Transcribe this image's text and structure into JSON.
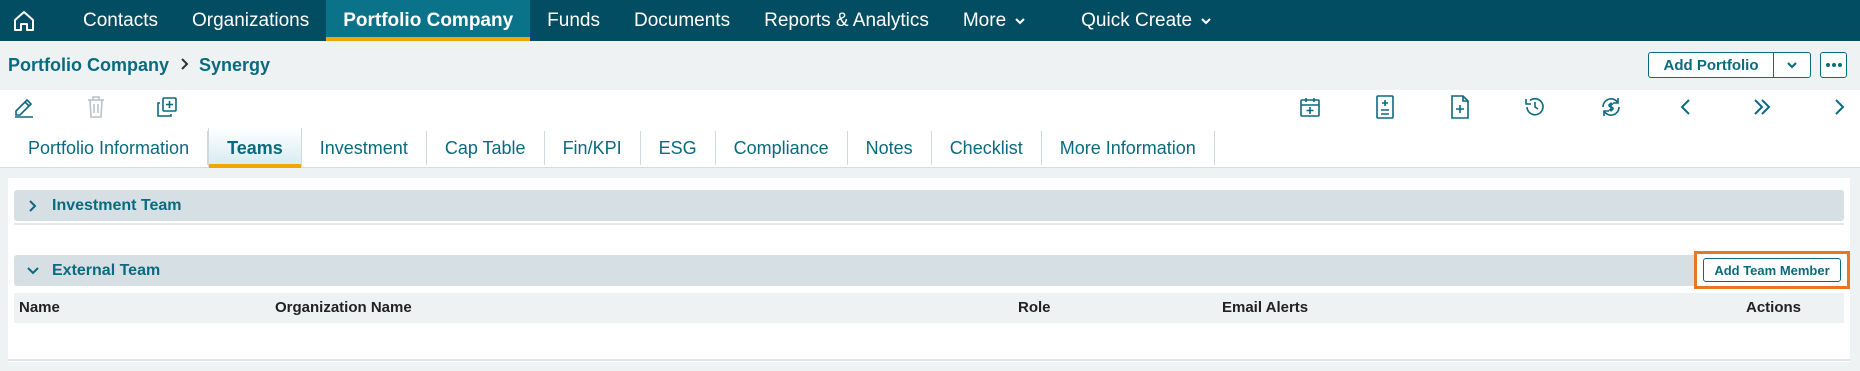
{
  "nav": {
    "items": [
      {
        "label": "Contacts"
      },
      {
        "label": "Organizations"
      },
      {
        "label": "Portfolio Company"
      },
      {
        "label": "Funds"
      },
      {
        "label": "Documents"
      },
      {
        "label": "Reports & Analytics"
      },
      {
        "label": "More"
      },
      {
        "label": "Quick Create"
      }
    ]
  },
  "breadcrumb": {
    "root": "Portfolio Company",
    "current": "Synergy"
  },
  "header": {
    "add_portfolio_label": "Add Portfolio"
  },
  "tabs": [
    {
      "label": "Portfolio Information"
    },
    {
      "label": "Teams"
    },
    {
      "label": "Investment"
    },
    {
      "label": "Cap Table"
    },
    {
      "label": "Fin/KPI"
    },
    {
      "label": "ESG"
    },
    {
      "label": "Compliance"
    },
    {
      "label": "Notes"
    },
    {
      "label": "Checklist"
    },
    {
      "label": "More Information"
    }
  ],
  "sections": {
    "investment_team": {
      "title": "Investment Team"
    },
    "external_team": {
      "title": "External Team",
      "add_button": "Add Team Member",
      "columns": [
        "Name",
        "Organization Name",
        "Role",
        "Email Alerts",
        "Actions"
      ]
    }
  },
  "colors": {
    "nav_bg": "#034d63",
    "accent": "#0a6a7e",
    "active_underline": "#f0a800",
    "highlight": "#e87722"
  },
  "icons": {
    "nav": [
      "home-icon",
      "chevron-down-icon"
    ],
    "toolbar": [
      "edit-icon",
      "delete-icon",
      "copy-icon",
      "calendar-icon",
      "calculator-doc-icon",
      "add-document-icon",
      "history-icon",
      "refresh-dollar-icon",
      "chevron-left-icon",
      "double-chevron-right-icon",
      "chevron-right-icon"
    ]
  }
}
